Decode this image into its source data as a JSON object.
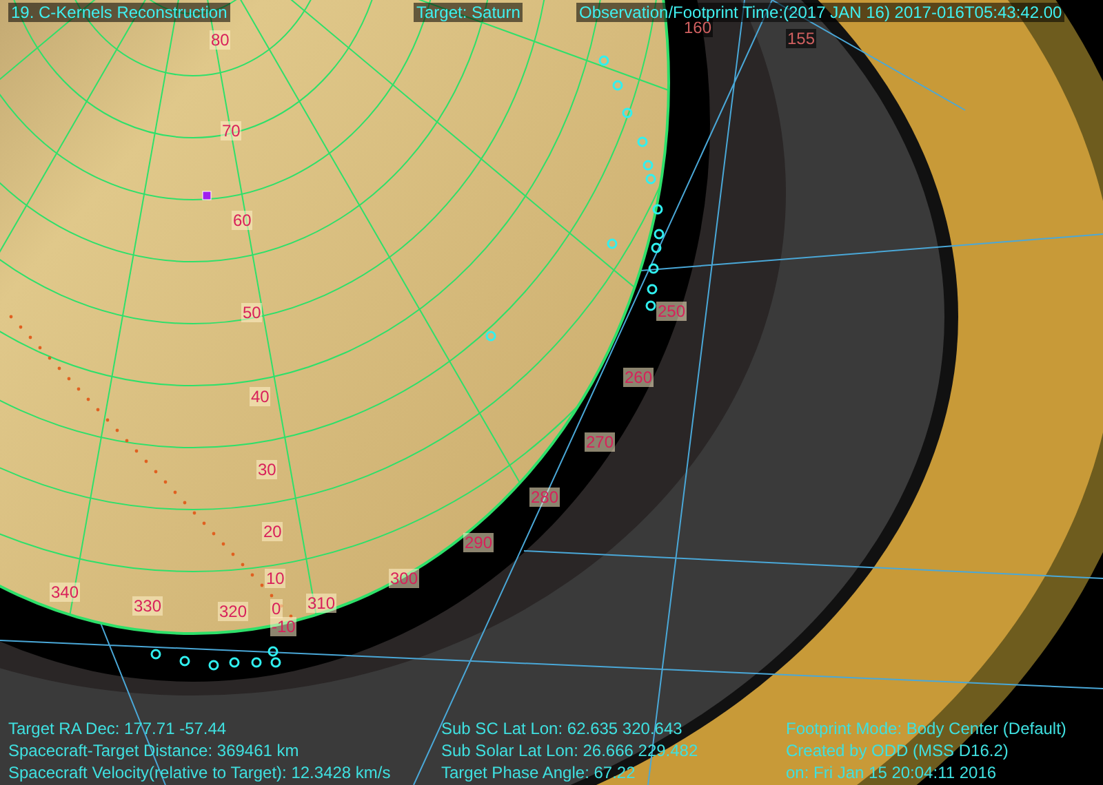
{
  "header": {
    "title": "19. C-Kernels Reconstruction",
    "target": "Target: Saturn",
    "time": "Observation/Footprint Time:(2017 JAN 16) 2017-016T05:43:42.00"
  },
  "latitude_labels": [
    "80",
    "70",
    "60",
    "50",
    "40",
    "30",
    "20",
    "10",
    "0",
    "-10"
  ],
  "longitude_labels": [
    "250",
    "260",
    "270",
    "280",
    "290",
    "300",
    "310",
    "320",
    "330",
    "340"
  ],
  "ring_labels": [
    "160",
    "155"
  ],
  "footer": [
    [
      "Target RA Dec: 177.71  -57.44",
      "Spacecraft-Target Distance:  369461 km",
      "Spacecraft Velocity(relative to Target): 12.3428 km/s"
    ],
    [
      "Sub SC Lat Lon: 62.635  320.643",
      "Sub Solar Lat Lon: 26.666  229.482",
      "Target Phase Angle: 67.22"
    ],
    [
      "Footprint Mode: Body Center (Default)",
      "Created by ODD (MSS D16.2)",
      "on: Fri Jan 15 20:04:11 2016"
    ]
  ]
}
